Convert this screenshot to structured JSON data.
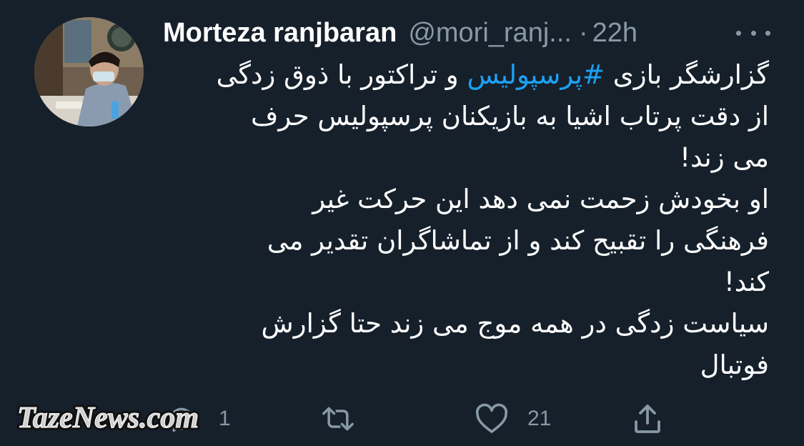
{
  "tweet": {
    "display_name": "Morteza ranjbaran",
    "handle": "@mori_ranj...",
    "separator": "·",
    "time": "22h",
    "body": {
      "line1_before": "گزارشگر بازی ",
      "hashtag": "#پرسپولیس",
      "line1_after": " و تراکتور با ذوق زدگی",
      "line2": "از دقت پرتاب اشیا به بازیکنان پرسپولیس حرف",
      "line3": "می زند!",
      "line4": "او بخودش زحمت نمی دهد این حرکت غیر",
      "line5": "فرهنگی را تقبیح کند و از تماشاگران تقدیر می",
      "line6": "کند!",
      "line7": "سیاست زدگی در همه موج می زند حتا گزارش",
      "line8": "فوتبال"
    },
    "actions": {
      "reply_count": "1",
      "retweet_count": "",
      "like_count": "21"
    }
  },
  "watermark": {
    "text": "TazeNews.com"
  },
  "colors": {
    "background": "#15202b",
    "primary_text": "#ffffff",
    "secondary_text": "#8899a6",
    "link": "#1da1f2"
  },
  "icons": [
    "more-options-icon",
    "reply-icon",
    "retweet-icon",
    "like-icon",
    "share-icon"
  ]
}
